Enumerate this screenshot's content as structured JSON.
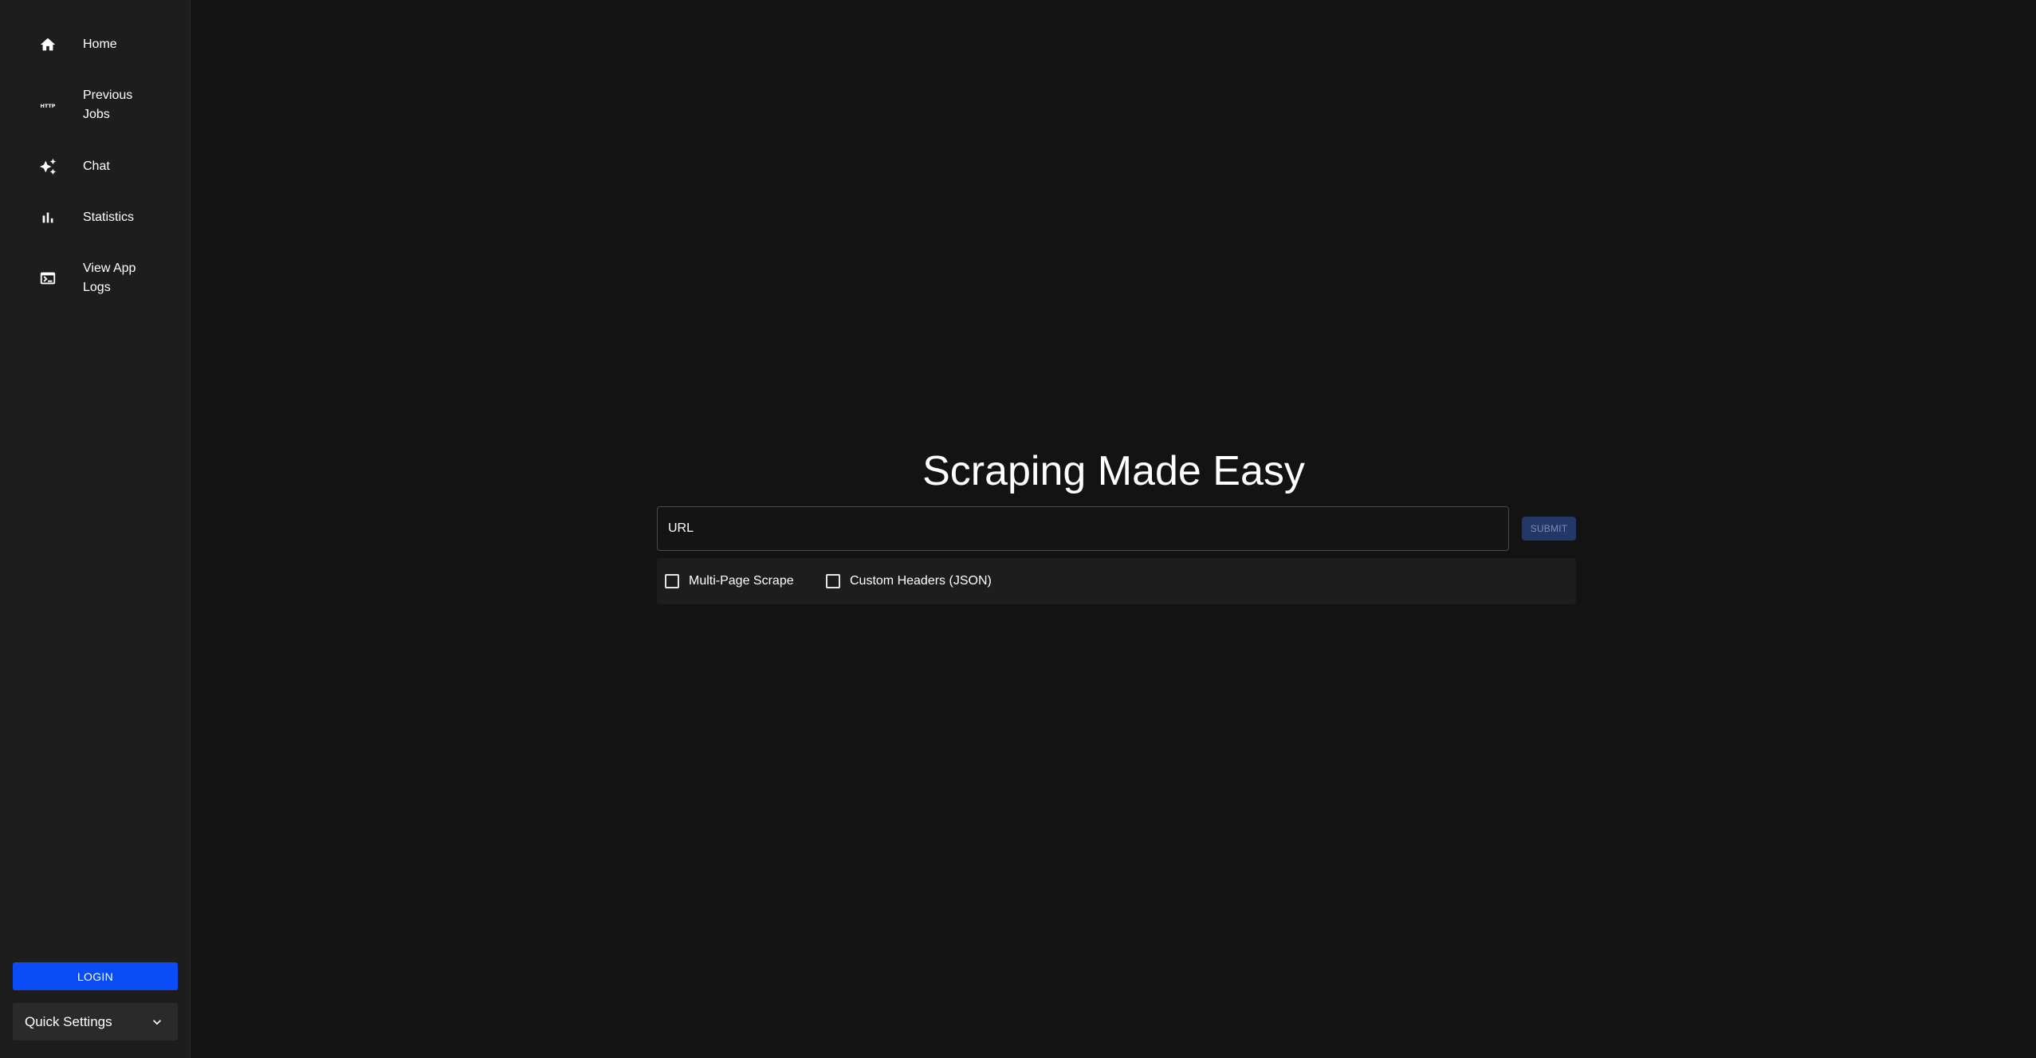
{
  "sidebar": {
    "nav": [
      {
        "label": "Home",
        "icon": "home-icon"
      },
      {
        "label": "Previous Jobs",
        "icon": "http-icon"
      },
      {
        "label": "Chat",
        "icon": "sparkle-icon"
      },
      {
        "label": "Statistics",
        "icon": "bar-chart-icon"
      },
      {
        "label": "View App Logs",
        "icon": "terminal-icon"
      }
    ],
    "login_label": "LOGIN",
    "quick_settings_label": "Quick Settings"
  },
  "main": {
    "title": "Scraping Made Easy",
    "url_placeholder": "URL",
    "submit_label": "SUBMIT",
    "options": [
      {
        "label": "Multi-Page Scrape",
        "checked": false
      },
      {
        "label": "Custom Headers (JSON)",
        "checked": false
      }
    ]
  },
  "colors": {
    "background": "#131313",
    "sidebar": "#1d1d1d",
    "accent": "#0a4cf5",
    "submit_disabled": "#233768"
  }
}
